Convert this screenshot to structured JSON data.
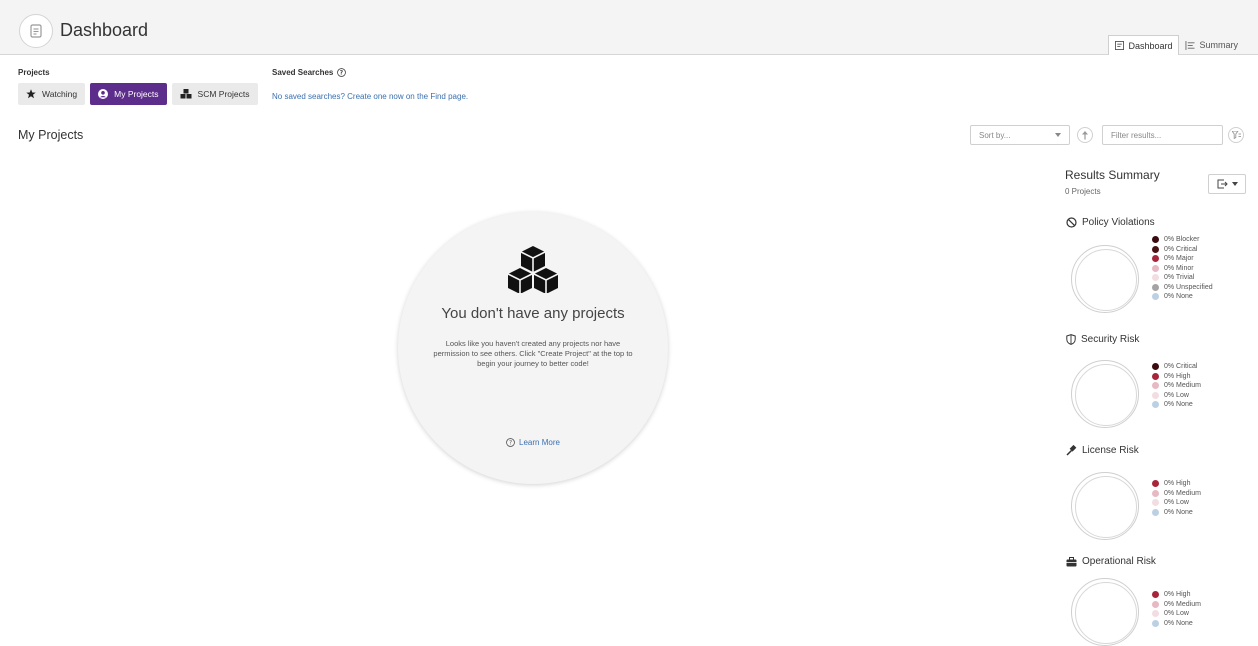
{
  "header": {
    "title": "Dashboard",
    "tabs": [
      {
        "label": "Dashboard",
        "icon": "dashboard-icon",
        "active": true
      },
      {
        "label": "Summary",
        "icon": "summary-list-icon",
        "active": false
      }
    ]
  },
  "projects": {
    "label": "Projects",
    "buttons": [
      {
        "label": "Watching",
        "icon": "star-icon",
        "active": false
      },
      {
        "label": "My Projects",
        "icon": "user-circle-icon",
        "active": true
      },
      {
        "label": "SCM Projects",
        "icon": "cubes-icon",
        "active": false
      }
    ]
  },
  "saved_searches": {
    "label": "Saved Searches",
    "text": "No saved searches? Create one now on the Find page."
  },
  "main": {
    "title": "My Projects",
    "sort_placeholder": "Sort by...",
    "filter_placeholder": "Filter results..."
  },
  "empty_state": {
    "title": "You don't have any projects",
    "text": "Looks like you haven't created any projects nor have permission to see others. Click \"Create Project\" at the top to begin your journey to better code!",
    "link": "Learn More"
  },
  "summary": {
    "title": "Results Summary",
    "count": "0 Projects",
    "panels": [
      {
        "title": "Policy Violations",
        "icon": "ban-icon",
        "items": [
          {
            "label": "0% Blocker",
            "color": "#3b0a0e"
          },
          {
            "label": "0% Critical",
            "color": "#4a1214"
          },
          {
            "label": "0% Major",
            "color": "#a8243a"
          },
          {
            "label": "0% Minor",
            "color": "#e7b9c4"
          },
          {
            "label": "0% Trivial",
            "color": "#f2dde2"
          },
          {
            "label": "0% Unspecified",
            "color": "#a4a4a4"
          },
          {
            "label": "0% None",
            "color": "#bcd0e4"
          }
        ]
      },
      {
        "title": "Security Risk",
        "icon": "shield-icon",
        "items": [
          {
            "label": "0% Critical",
            "color": "#3b0a0e"
          },
          {
            "label": "0% High",
            "color": "#a8243a"
          },
          {
            "label": "0% Medium",
            "color": "#e7b9c4"
          },
          {
            "label": "0% Low",
            "color": "#f2dde2"
          },
          {
            "label": "0% None",
            "color": "#bcd0e4"
          }
        ]
      },
      {
        "title": "License Risk",
        "icon": "gavel-icon",
        "items": [
          {
            "label": "0% High",
            "color": "#a8243a"
          },
          {
            "label": "0% Medium",
            "color": "#e7b9c4"
          },
          {
            "label": "0% Low",
            "color": "#f2dde2"
          },
          {
            "label": "0% None",
            "color": "#bcd0e4"
          }
        ]
      },
      {
        "title": "Operational Risk",
        "icon": "briefcase-icon",
        "items": [
          {
            "label": "0% High",
            "color": "#a8243a"
          },
          {
            "label": "0% Medium",
            "color": "#e7b9c4"
          },
          {
            "label": "0% Low",
            "color": "#f2dde2"
          },
          {
            "label": "0% None",
            "color": "#bcd0e4"
          }
        ]
      }
    ]
  },
  "colors": {
    "accent": "#5d2d8c",
    "link": "#3a70b0"
  }
}
